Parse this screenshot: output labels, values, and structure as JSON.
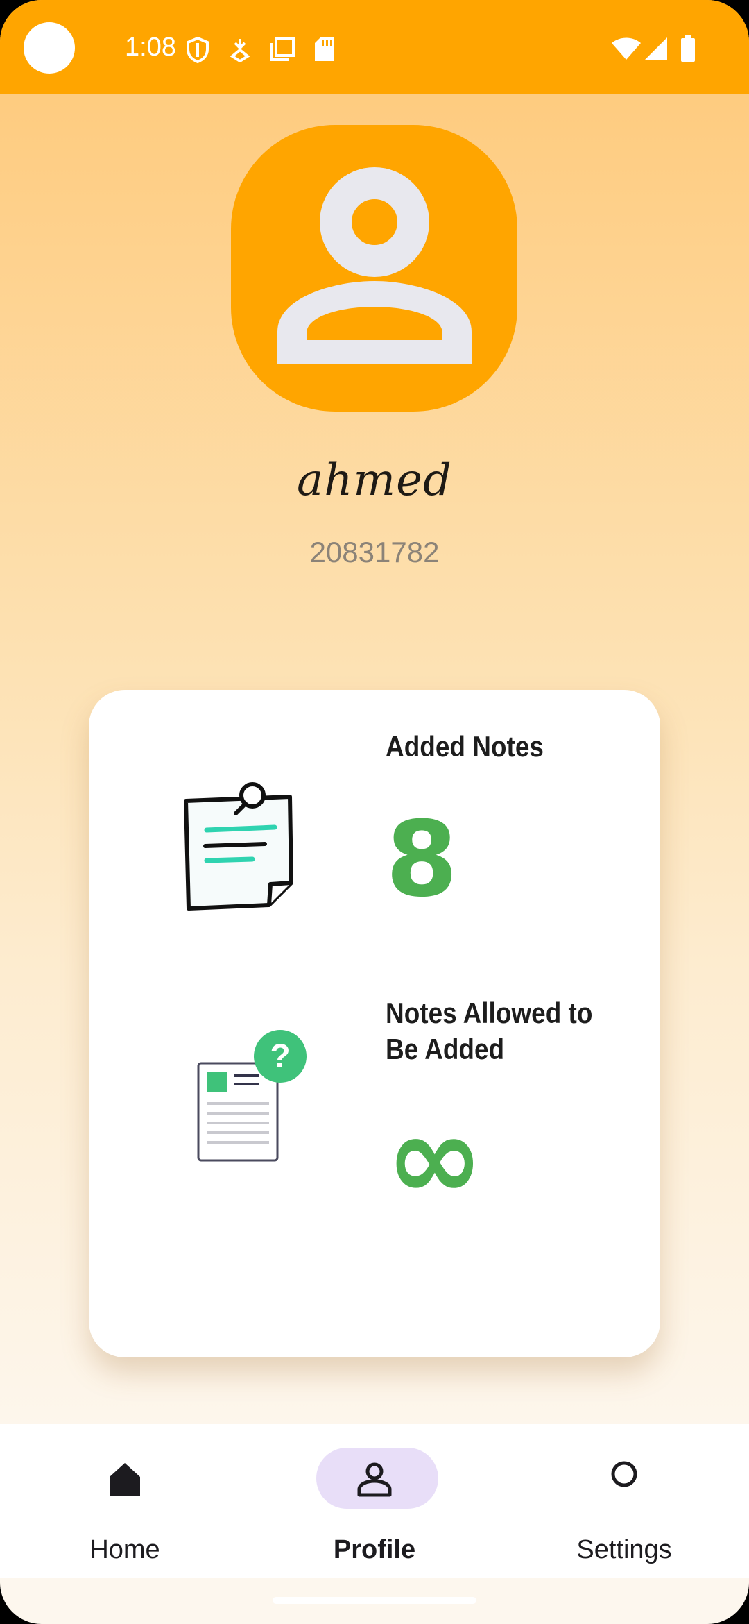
{
  "status_bar": {
    "time": "1:08",
    "background_color": "#ffa500",
    "left_icons": [
      "shield-icon",
      "download-icon",
      "copy-icon",
      "sd-card-icon"
    ],
    "right_icons": [
      "wifi-icon",
      "signal-icon",
      "battery-icon"
    ]
  },
  "profile": {
    "avatar_icon": "person-icon",
    "name": "ahmed",
    "id": "20831782"
  },
  "stats": {
    "added_notes_label": "Added Notes",
    "added_notes_value": "8",
    "allowed_label": "Notes Allowed to Be Added",
    "allowed_value": "∞",
    "value_color": "#4caf50"
  },
  "nav": {
    "items": [
      {
        "label": "Home",
        "icon": "home-icon",
        "active": false
      },
      {
        "label": "Profile",
        "icon": "person-icon",
        "active": true
      },
      {
        "label": "Settings",
        "icon": "circle-icon",
        "active": false
      }
    ]
  },
  "colors": {
    "accent": "#ffa500",
    "nav_active_pill": "#e8def8"
  }
}
